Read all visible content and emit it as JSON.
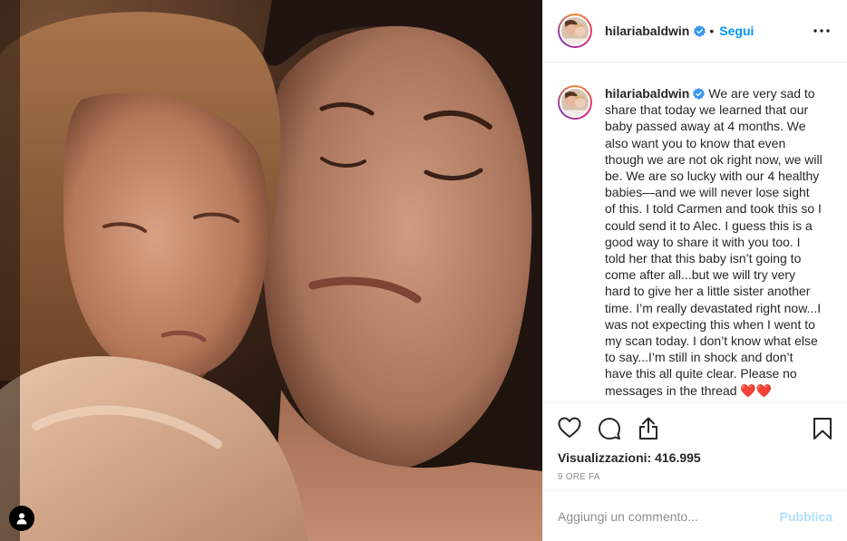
{
  "post": {
    "username": "hilariabaldwin",
    "verified": true,
    "follow_label": "Segui",
    "separator": "•",
    "caption": "We are very sad to share that today we learned that our baby passed away at 4 months. We also want you to know that even though we are not ok right now, we will be. We are so lucky with our 4 healthy babies—and we will never lose sight of this. I told Carmen and took this so I could send it to Alec. I guess this is a good way to share it with you too. I told her that this baby isn’t going to come after all...but we will try very hard to give her a little sister another time. I’m really devastated right now...I was not expecting this when I went to my scan today. I don’t know what else to say...I’m still in shock and don’t have this all quite clear. Please no messages in the thread ❤️❤️",
    "views_label": "Visualizzazioni:",
    "views_count": "416.995",
    "time_ago": "9 ORE FA"
  },
  "comment_box": {
    "placeholder": "Aggiungi un commento...",
    "post_label": "Pubblica"
  },
  "icons": {
    "verified": "verified-badge-icon",
    "more": "more-options-icon",
    "like": "heart-icon",
    "comment": "comment-icon",
    "share": "share-icon",
    "save": "bookmark-icon",
    "user_tag": "user-tag-icon"
  },
  "colors": {
    "accent_blue": "#0095f6",
    "post_button_disabled": "#b2dffc",
    "verified_blue": "#3897f0",
    "border": "#efefef",
    "muted_text": "#8e8e8e"
  }
}
